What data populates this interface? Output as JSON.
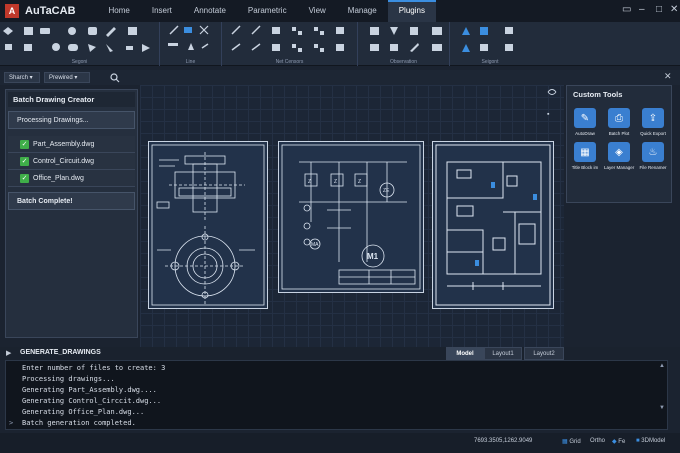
{
  "app": {
    "name": "AuTaCAB"
  },
  "menu": {
    "tabs": [
      "Home",
      "Insert",
      "Annotate",
      "Parametric",
      "View",
      "Manage",
      "Plugins"
    ],
    "active": "Plugins"
  },
  "ribbon": {
    "groups": [
      "Segoni",
      "Line",
      "Net Censors",
      "Observation",
      "Seigont"
    ]
  },
  "toolbar": {
    "search_label": "Sharch",
    "predefined_label": "Prewired"
  },
  "left_panel": {
    "title": "Batch Drawing Creator",
    "processing": "Processing Drawings...",
    "files": [
      "Part_Assembly.dwg",
      "Control_Circuit.dwg",
      "Office_Plan.dwg"
    ],
    "complete": "Batch Complete!"
  },
  "drawings": {
    "motor_label": "M1"
  },
  "right_panel": {
    "title": "Custom Tools",
    "tools": [
      {
        "label": "AutoDraw",
        "icon": "autodraw-icon"
      },
      {
        "label": "Batch Plot",
        "icon": "batch-plot-icon"
      },
      {
        "label": "Quick Export",
        "icon": "quick-export-icon"
      },
      {
        "label": "Title Block im",
        "icon": "title-block-icon"
      },
      {
        "label": "Layer Manager",
        "icon": "layer-manager-icon"
      },
      {
        "label": "File Renamer",
        "icon": "file-renamer-icon"
      }
    ]
  },
  "command": {
    "title": "GENERATE_DRAWINGS",
    "lines": [
      "Enter number of files to create: 3",
      "Processing drawings...",
      "Generating Part_Assembly.dwg....",
      "Generating Control_Circcit.dwg...",
      "Generating Office_Plan.dwg...",
      "Batch generation completed."
    ]
  },
  "layout_tabs": [
    "Model",
    "Layout1",
    "Layout2"
  ],
  "status": {
    "coords": "7693.3505,1262.9049",
    "grid": "Grid",
    "ortho": "Ortho",
    "fe": "Fe",
    "model": "3DModel"
  },
  "colors": {
    "accent": "#3b8ee0",
    "check": "#3fae49",
    "background": "#1b2330"
  }
}
